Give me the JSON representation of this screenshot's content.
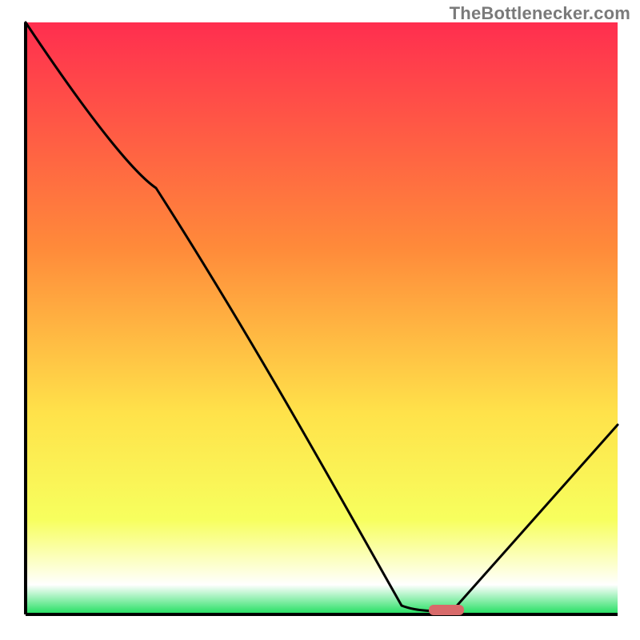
{
  "watermark": "TheBottlenecker.com",
  "colors": {
    "gradient_red": "#ff2e4f",
    "gradient_orange": "#ff8a3a",
    "gradient_yellow": "#ffe24a",
    "gradient_lemon": "#f7ff5e",
    "gradient_white": "#ffffff",
    "gradient_green": "#1fdf5e",
    "axis": "#000000",
    "curve": "#000000",
    "marker_fill": "#d86a6a",
    "marker_outline": "none"
  },
  "chart_data": {
    "type": "line",
    "title": "",
    "xlabel": "",
    "ylabel": "",
    "xlim": [
      0,
      100
    ],
    "ylim": [
      0,
      100
    ],
    "grid": false,
    "legend": false,
    "series": [
      {
        "name": "bottleneck-curve",
        "x": [
          0,
          22,
          63.5,
          70,
          72,
          100
        ],
        "y": [
          100,
          72,
          1.5,
          0.5,
          0.7,
          32
        ]
      }
    ],
    "marker": {
      "name": "current-bottleneck-marker",
      "x": 71,
      "y": 0.5,
      "width": 5,
      "height": 1.6
    }
  }
}
